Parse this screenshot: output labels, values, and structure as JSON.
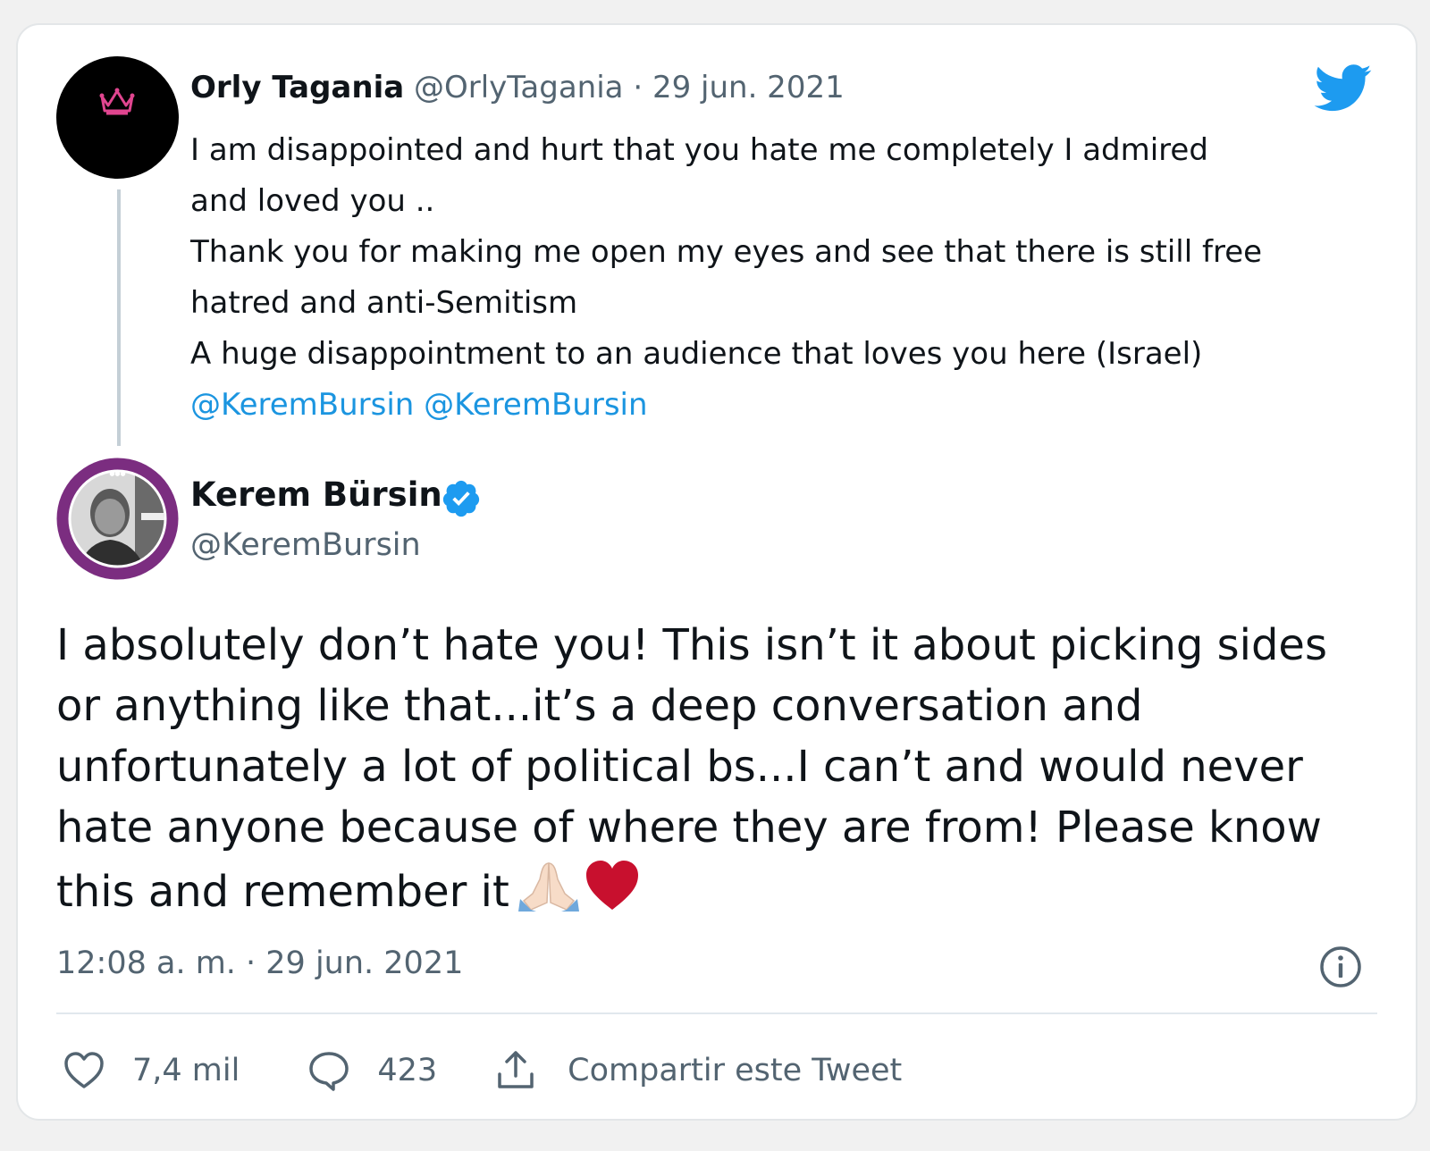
{
  "colors": {
    "twitter_blue": "#1d9bf0",
    "text_primary": "#0f1419",
    "text_secondary": "#536471",
    "mention": "#1b95e0"
  },
  "logo": {
    "icon": "twitter-bird-icon"
  },
  "parent_tweet": {
    "display_name": "Orly Tagania",
    "handle": "@OrlyTagania",
    "separator": " · ",
    "date": "29 jun. 2021",
    "body_lines": [
      "I am disappointed and hurt that you hate me completely I admired",
      "and loved you ..",
      "Thank you for making me open my eyes and see that there is still free",
      "hatred and anti-Semitism",
      "A huge disappointment to an audience that loves you here (Israel)"
    ],
    "mentions": [
      "@KeremBursin",
      "@KeremBursin"
    ]
  },
  "reply_tweet": {
    "display_name": "Kerem Bürsin",
    "verified": true,
    "handle": "@KeremBursin",
    "body_lines": [
      "I absolutely don’t hate you! This isn’t it about picking sides",
      "or anything like that...it’s a deep conversation and",
      "unfortunately a lot of political bs...I can’t and would never",
      "hate anyone because of where they are from! Please know",
      "this and remember it"
    ],
    "emojis": [
      "folded-hands-emoji",
      "red-heart-emoji"
    ],
    "timestamp": "12:08 a. m. · 29 jun. 2021"
  },
  "actions": {
    "likes": "7,4 mil",
    "replies": "423",
    "share_label": "Compartir este Tweet"
  }
}
